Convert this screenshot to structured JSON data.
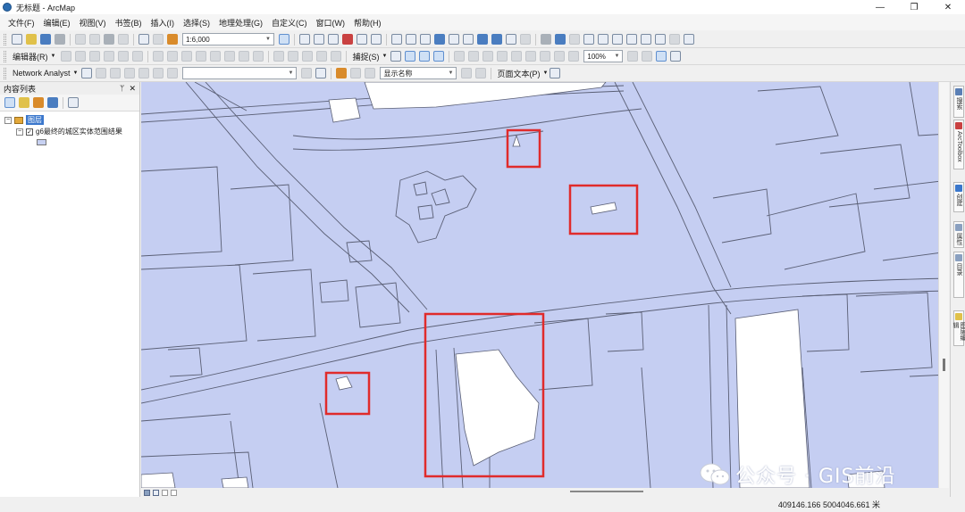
{
  "window": {
    "title": "无标题 - ArcMap",
    "minimize_glyph": "—",
    "restore_glyph": "❐",
    "close_glyph": "✕"
  },
  "menu": [
    "文件(F)",
    "编辑(E)",
    "视图(V)",
    "书签(B)",
    "插入(I)",
    "选择(S)",
    "地理处理(G)",
    "自定义(C)",
    "窗口(W)",
    "帮助(H)"
  ],
  "standard_toolbar": {
    "scale_value": "1:6,000"
  },
  "editor_toolbar": {
    "editor_label": "编辑器(R)",
    "snapping_label": "捕捉(S)",
    "zoom_percent": "100%"
  },
  "network_toolbar": {
    "network_label": "Network Analyst",
    "display_name_combo": "显示名称",
    "page_text_label": "页面文本(P)"
  },
  "toc": {
    "title": "内容列表",
    "pin_glyph": "ᛘ",
    "close_glyph": "✕",
    "group_label": "图层",
    "layer_label": "g6最终的城区实体范围结果",
    "layer_checked": true,
    "expand_glyph": "−",
    "check_glyph": "✓"
  },
  "map": {
    "fill_color": "#c5cef2",
    "line_color": "#5a5f75",
    "highlight_color": "#e02b2b",
    "hole_color": "#ffffff"
  },
  "right_dock": {
    "tabs": [
      {
        "label": "搜索",
        "icon": "search-window-icon"
      },
      {
        "label": "ArcToolbox",
        "icon": "toolbox-icon"
      },
      {
        "label": "创建",
        "icon": "create-features-icon"
      },
      {
        "label": "属性",
        "icon": "attributes-icon"
      },
      {
        "label": "目录",
        "icon": "catalog-icon"
      },
      {
        "label": "图层编辑",
        "icon": "layer-edit-icon"
      }
    ]
  },
  "status": {
    "coordinates": "409146.166  5004046.661 米"
  },
  "watermark": {
    "text": "公众号 · GIS前沿"
  }
}
